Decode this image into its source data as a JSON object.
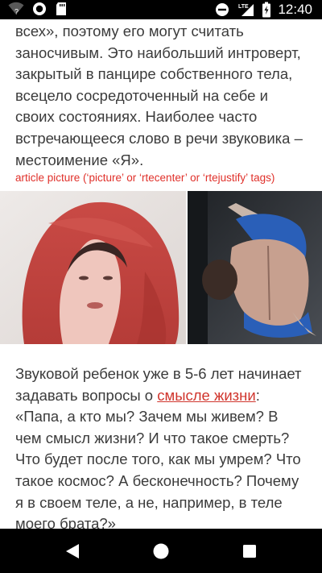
{
  "status_bar": {
    "time": "12:40",
    "network_label": "LTE",
    "icons": [
      "wifi-question-icon",
      "circle-notification-icon",
      "sd-card-icon",
      "do-not-disturb-icon",
      "cellular-signal-icon",
      "battery-charging-icon"
    ]
  },
  "article": {
    "paragraph1": "всех», поэтому его могут считать заносчивым. Это наибольший интроверт, закрытый в панцире собственного тела, всецело сосредоточенный на себе и своих состояниях. Наиболее часто встречающееся слово в речи звуковика – местоимение «Я».",
    "caption": "article picture (‘picture’ or ‘rtecenter’ or ‘rtejustify’ tags)",
    "paragraph2_before_link": "Звуковой ребенок уже в 5-6 лет начинает задавать вопросы о ",
    "link_text": "смысле жизни",
    "paragraph2_after_link": ": «Папа, а кто мы? Зачем мы живем? В чем смысл жизни? И что такое смерть? Что будет после того, как мы умрем? Что такое космос? А бесконечность? Почему я в своем теле, а не, например, в теле моего брата?»",
    "colors": {
      "text": "#3b3b3b",
      "caption": "#e0302a",
      "link": "#d0352d"
    }
  },
  "nav_bar": {
    "buttons": [
      "back-icon",
      "home-icon",
      "recents-icon"
    ]
  }
}
